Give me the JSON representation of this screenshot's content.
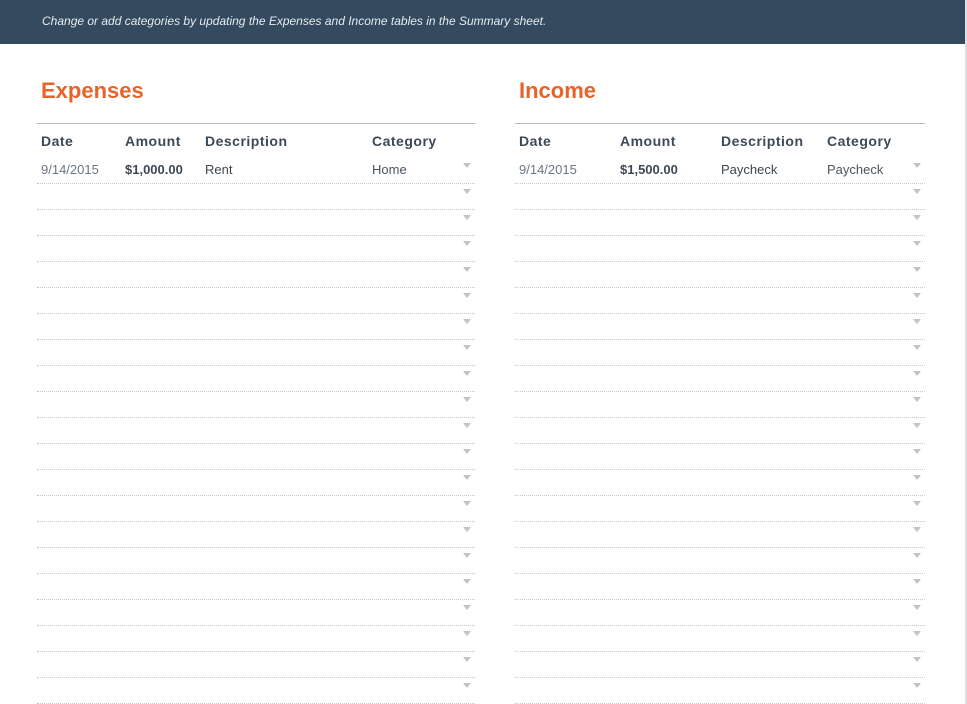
{
  "banner": {
    "text": "Change or add categories by updating the Expenses and Income tables in the Summary sheet."
  },
  "expenses": {
    "title": "Expenses",
    "columns": [
      "Date",
      "Amount",
      "Description",
      "Category"
    ],
    "rows": [
      {
        "date": "9/14/2015",
        "amount": "$1,000.00",
        "description": "Rent",
        "category": "Home"
      },
      {
        "date": "",
        "amount": "",
        "description": "",
        "category": ""
      },
      {
        "date": "",
        "amount": "",
        "description": "",
        "category": ""
      },
      {
        "date": "",
        "amount": "",
        "description": "",
        "category": ""
      },
      {
        "date": "",
        "amount": "",
        "description": "",
        "category": ""
      },
      {
        "date": "",
        "amount": "",
        "description": "",
        "category": ""
      },
      {
        "date": "",
        "amount": "",
        "description": "",
        "category": ""
      },
      {
        "date": "",
        "amount": "",
        "description": "",
        "category": ""
      },
      {
        "date": "",
        "amount": "",
        "description": "",
        "category": ""
      },
      {
        "date": "",
        "amount": "",
        "description": "",
        "category": ""
      },
      {
        "date": "",
        "amount": "",
        "description": "",
        "category": ""
      },
      {
        "date": "",
        "amount": "",
        "description": "",
        "category": ""
      },
      {
        "date": "",
        "amount": "",
        "description": "",
        "category": ""
      },
      {
        "date": "",
        "amount": "",
        "description": "",
        "category": ""
      },
      {
        "date": "",
        "amount": "",
        "description": "",
        "category": ""
      },
      {
        "date": "",
        "amount": "",
        "description": "",
        "category": ""
      },
      {
        "date": "",
        "amount": "",
        "description": "",
        "category": ""
      },
      {
        "date": "",
        "amount": "",
        "description": "",
        "category": ""
      },
      {
        "date": "",
        "amount": "",
        "description": "",
        "category": ""
      },
      {
        "date": "",
        "amount": "",
        "description": "",
        "category": ""
      },
      {
        "date": "",
        "amount": "",
        "description": "",
        "category": ""
      }
    ]
  },
  "income": {
    "title": "Income",
    "columns": [
      "Date",
      "Amount",
      "Description",
      "Category"
    ],
    "rows": [
      {
        "date": "9/14/2015",
        "amount": "$1,500.00",
        "description": "Paycheck",
        "category": "Paycheck"
      },
      {
        "date": "",
        "amount": "",
        "description": "",
        "category": ""
      },
      {
        "date": "",
        "amount": "",
        "description": "",
        "category": ""
      },
      {
        "date": "",
        "amount": "",
        "description": "",
        "category": ""
      },
      {
        "date": "",
        "amount": "",
        "description": "",
        "category": ""
      },
      {
        "date": "",
        "amount": "",
        "description": "",
        "category": ""
      },
      {
        "date": "",
        "amount": "",
        "description": "",
        "category": ""
      },
      {
        "date": "",
        "amount": "",
        "description": "",
        "category": ""
      },
      {
        "date": "",
        "amount": "",
        "description": "",
        "category": ""
      },
      {
        "date": "",
        "amount": "",
        "description": "",
        "category": ""
      },
      {
        "date": "",
        "amount": "",
        "description": "",
        "category": ""
      },
      {
        "date": "",
        "amount": "",
        "description": "",
        "category": ""
      },
      {
        "date": "",
        "amount": "",
        "description": "",
        "category": ""
      },
      {
        "date": "",
        "amount": "",
        "description": "",
        "category": ""
      },
      {
        "date": "",
        "amount": "",
        "description": "",
        "category": ""
      },
      {
        "date": "",
        "amount": "",
        "description": "",
        "category": ""
      },
      {
        "date": "",
        "amount": "",
        "description": "",
        "category": ""
      },
      {
        "date": "",
        "amount": "",
        "description": "",
        "category": ""
      },
      {
        "date": "",
        "amount": "",
        "description": "",
        "category": ""
      },
      {
        "date": "",
        "amount": "",
        "description": "",
        "category": ""
      },
      {
        "date": "",
        "amount": "",
        "description": "",
        "category": ""
      }
    ]
  },
  "icons": {
    "category_dropdown": "chevron-down-icon"
  },
  "colors": {
    "banner_bg": "#344a5f",
    "title_accent": "#e8632a",
    "header_text": "#3c4a57"
  }
}
